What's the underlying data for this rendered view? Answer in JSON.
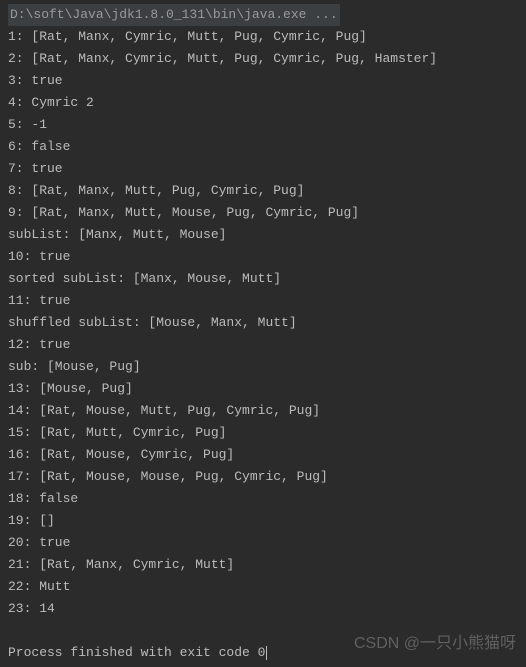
{
  "command": "D:\\soft\\Java\\jdk1.8.0_131\\bin\\java.exe ...",
  "lines": [
    "1: [Rat, Manx, Cymric, Mutt, Pug, Cymric, Pug]",
    "2: [Rat, Manx, Cymric, Mutt, Pug, Cymric, Pug, Hamster]",
    "3: true",
    "4: Cymric 2",
    "5: -1",
    "6: false",
    "7: true",
    "8: [Rat, Manx, Mutt, Pug, Cymric, Pug]",
    "9: [Rat, Manx, Mutt, Mouse, Pug, Cymric, Pug]",
    "subList: [Manx, Mutt, Mouse]",
    "10: true",
    "sorted subList: [Manx, Mouse, Mutt]",
    "11: true",
    "shuffled subList: [Mouse, Manx, Mutt]",
    "12: true",
    "sub: [Mouse, Pug]",
    "13: [Mouse, Pug]",
    "14: [Rat, Mouse, Mutt, Pug, Cymric, Pug]",
    "15: [Rat, Mutt, Cymric, Pug]",
    "16: [Rat, Mouse, Cymric, Pug]",
    "17: [Rat, Mouse, Mouse, Pug, Cymric, Pug]",
    "18: false",
    "19: []",
    "20: true",
    "21: [Rat, Manx, Cymric, Mutt]",
    "22: Mutt",
    "23: 14"
  ],
  "process": "Process finished with exit code 0",
  "watermark": "CSDN @一只小熊猫呀"
}
